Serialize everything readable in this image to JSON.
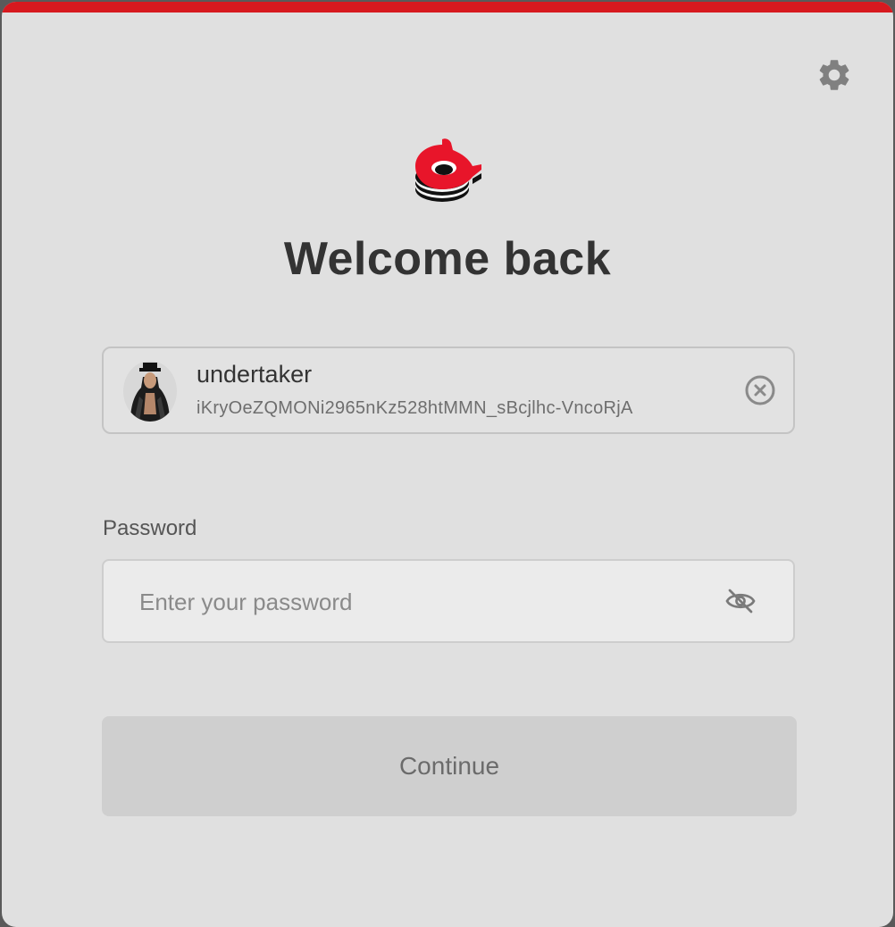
{
  "window": {
    "accent_color": "#d7191f"
  },
  "header": {
    "settings_icon": "gear-icon",
    "logo_icon": "app-logo-icon",
    "title": "Welcome back"
  },
  "account": {
    "name": "undertaker",
    "public_key": "iKryOeZQMONi2965nKz528htMMN_sBcjlhc-VncoRjA",
    "avatar_icon": "avatar",
    "clear_icon": "close-circle-icon"
  },
  "password": {
    "label": "Password",
    "placeholder": "Enter your password",
    "value": "",
    "visibility_icon": "eye-off-icon"
  },
  "actions": {
    "continue_label": "Continue"
  }
}
